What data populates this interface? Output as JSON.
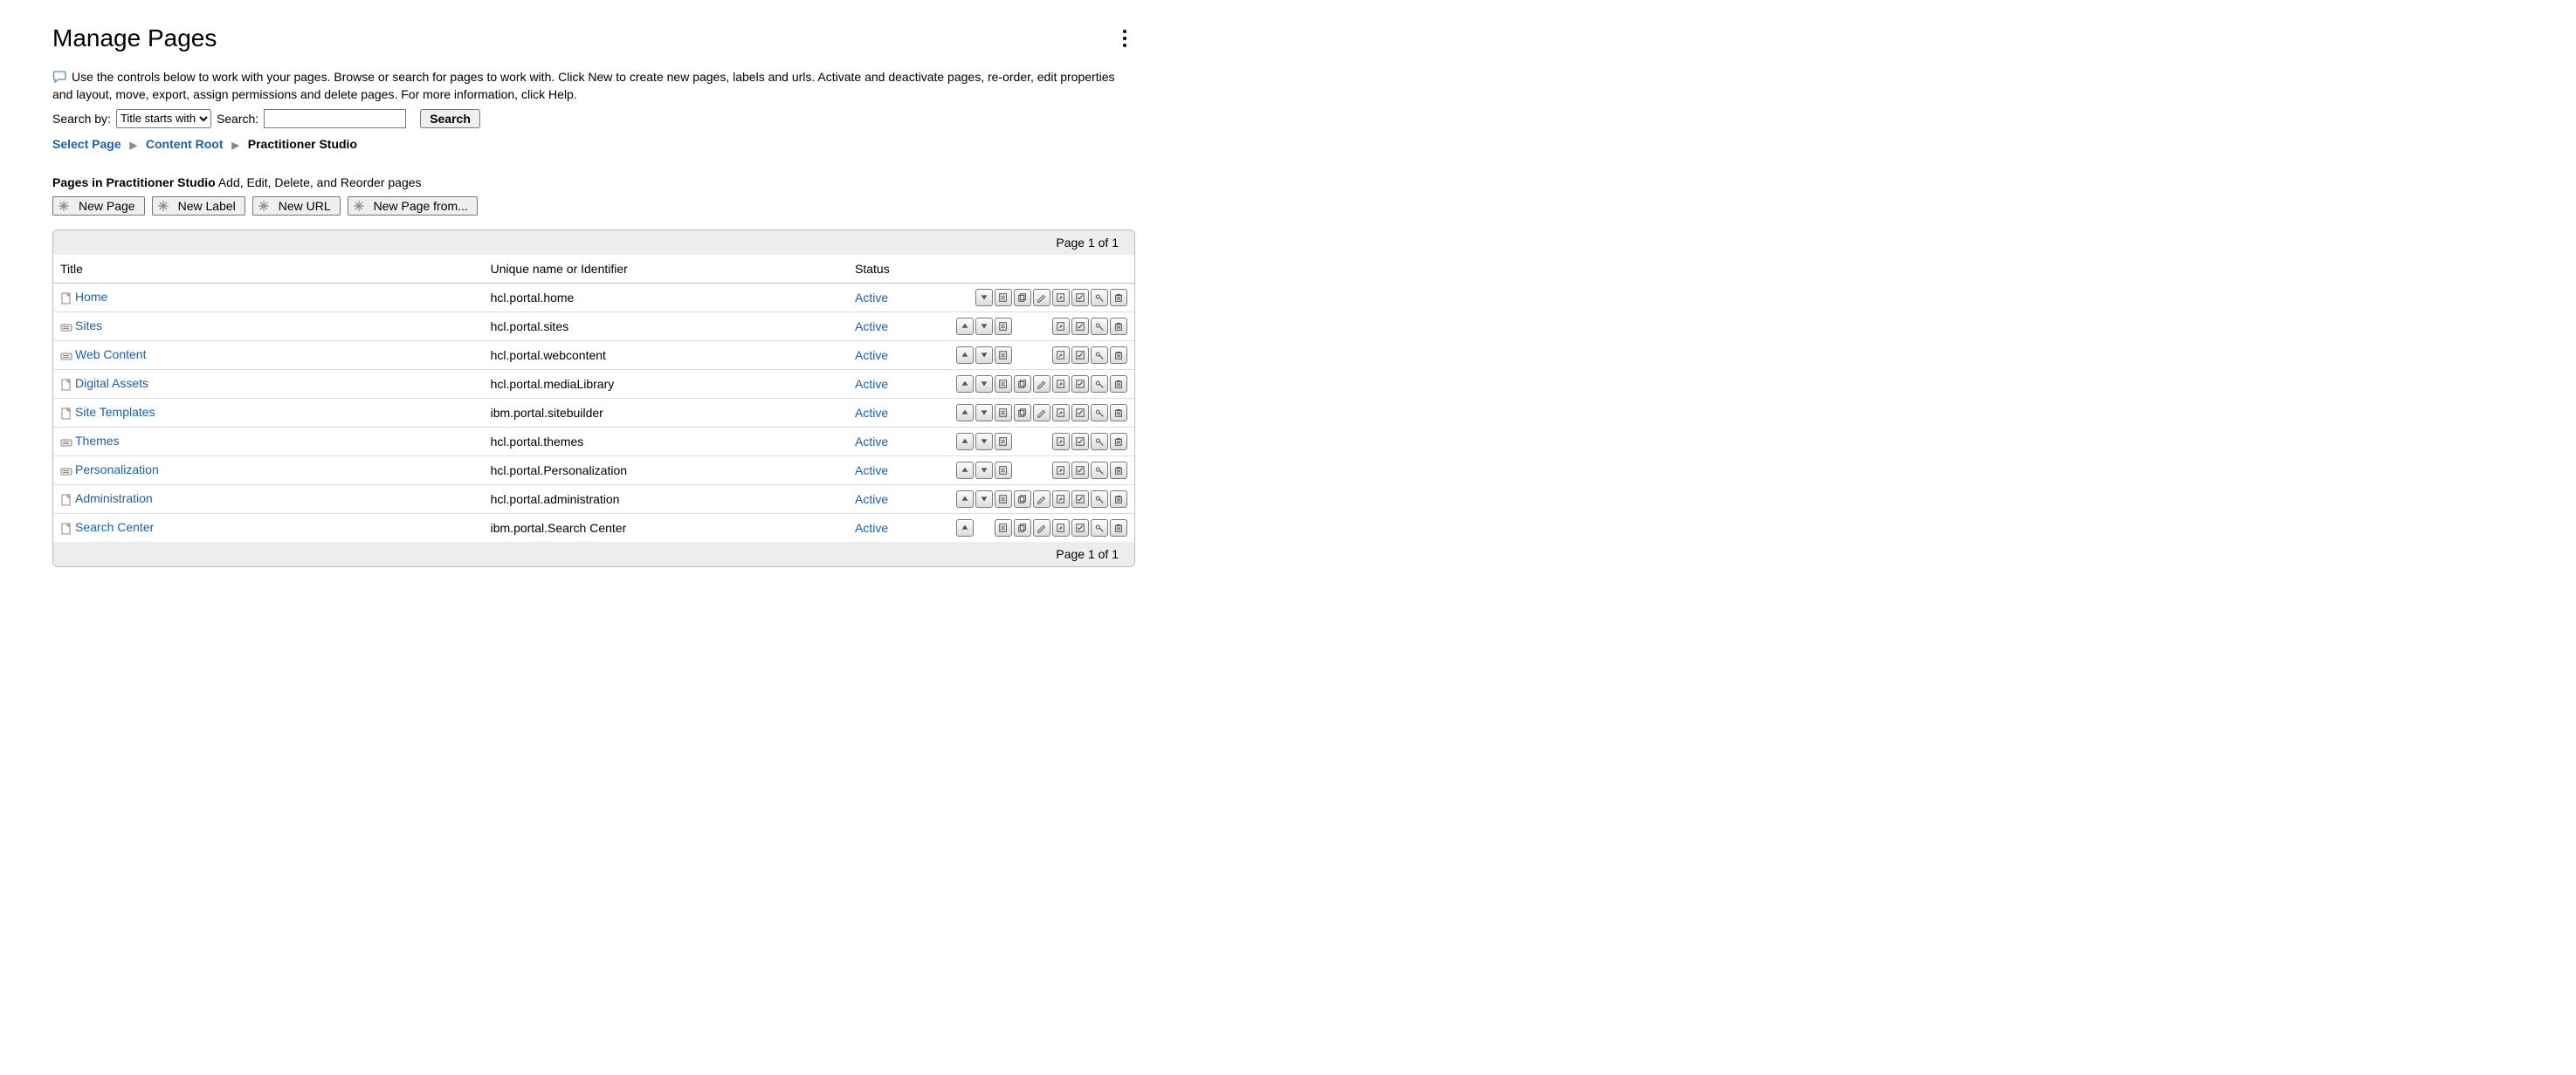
{
  "header": {
    "title": "Manage Pages"
  },
  "help": {
    "text": "Use the controls below to work with your pages. Browse or search for pages to work with. Click New to create new pages, labels and urls. Activate and deactivate pages, re-order, edit properties and layout, move, export, assign permissions and delete pages. For more information, click Help."
  },
  "search": {
    "by_label": "Search by:",
    "by_value": "Title starts with",
    "label": "Search:",
    "input_value": "",
    "button": "Search"
  },
  "breadcrumb": {
    "select_page": "Select Page",
    "content_root": "Content Root",
    "current": "Practitioner Studio"
  },
  "section": {
    "prefix": "Pages in ",
    "context": "Practitioner Studio",
    "suffix": " Add, Edit, Delete, and Reorder pages"
  },
  "toolbar": {
    "new_page": "New Page",
    "new_label": "New Label",
    "new_url": "New URL",
    "new_page_from": "New Page from..."
  },
  "pager": {
    "text": "Page 1 of 1"
  },
  "columns": {
    "title": "Title",
    "uid": "Unique name or Identifier",
    "status": "Status"
  },
  "action_names": [
    "move-up",
    "move-down",
    "properties",
    "copy",
    "edit",
    "export",
    "mark",
    "permissions",
    "delete"
  ],
  "rows": [
    {
      "icon": "page",
      "title": "Home",
      "uid": "hcl.portal.home",
      "status": "Active",
      "actions": [
        0,
        1,
        1,
        1,
        1,
        1,
        1,
        1,
        1
      ]
    },
    {
      "icon": "label",
      "title": "Sites",
      "uid": "hcl.portal.sites",
      "status": "Active",
      "actions": [
        1,
        1,
        1,
        0,
        0,
        1,
        1,
        1,
        1
      ]
    },
    {
      "icon": "label",
      "title": "Web Content",
      "uid": "hcl.portal.webcontent",
      "status": "Active",
      "actions": [
        1,
        1,
        1,
        0,
        0,
        1,
        1,
        1,
        1
      ]
    },
    {
      "icon": "page",
      "title": "Digital Assets",
      "uid": "hcl.portal.mediaLibrary",
      "status": "Active",
      "actions": [
        1,
        1,
        1,
        1,
        1,
        1,
        1,
        1,
        1
      ]
    },
    {
      "icon": "page",
      "title": "Site Templates",
      "uid": "ibm.portal.sitebuilder",
      "status": "Active",
      "actions": [
        1,
        1,
        1,
        1,
        1,
        1,
        1,
        1,
        1
      ]
    },
    {
      "icon": "label",
      "title": "Themes",
      "uid": "hcl.portal.themes",
      "status": "Active",
      "actions": [
        1,
        1,
        1,
        0,
        0,
        1,
        1,
        1,
        1
      ]
    },
    {
      "icon": "label",
      "title": "Personalization",
      "uid": "hcl.portal.Personalization",
      "status": "Active",
      "actions": [
        1,
        1,
        1,
        0,
        0,
        1,
        1,
        1,
        1
      ]
    },
    {
      "icon": "page",
      "title": "Administration",
      "uid": "hcl.portal.administration",
      "status": "Active",
      "actions": [
        1,
        1,
        1,
        1,
        1,
        1,
        1,
        1,
        1
      ]
    },
    {
      "icon": "page",
      "title": "Search Center",
      "uid": "ibm.portal.Search Center",
      "status": "Active",
      "actions": [
        1,
        0,
        1,
        1,
        1,
        1,
        1,
        1,
        1
      ]
    }
  ]
}
